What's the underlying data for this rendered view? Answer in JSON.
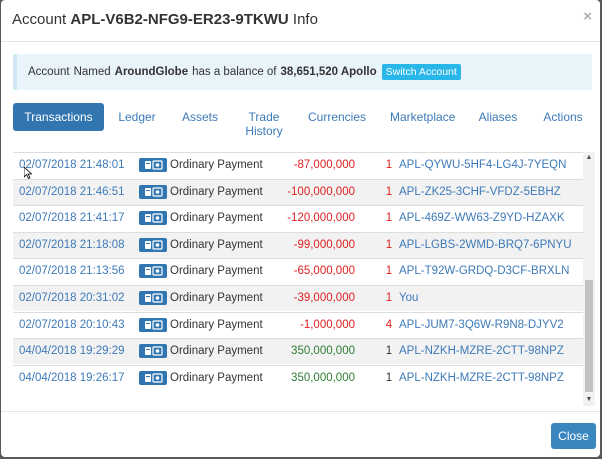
{
  "header": {
    "title_prefix": "Account",
    "account_id": "APL-V6B2-NFG9-ER23-9TKWU",
    "title_suffix": "Info",
    "close_glyph": "×"
  },
  "alert": {
    "prefix": "Account",
    "named": "Named",
    "name": "AroundGlobe",
    "balance_text": "has a balance of",
    "balance": "38,651,520 Apollo",
    "switch_label": "Switch Account"
  },
  "tabs": [
    {
      "label": "Transactions",
      "active": true
    },
    {
      "label": "Ledger"
    },
    {
      "label": "Assets"
    },
    {
      "label": "Trade",
      "label2": "History"
    },
    {
      "label": "Currencies"
    },
    {
      "label": "Marketplace"
    },
    {
      "label": "Aliases"
    },
    {
      "label": "Actions"
    }
  ],
  "transactions": [
    {
      "date": "02/07/2018 21:48:01",
      "type": "Ordinary Payment",
      "amount": "-87,000,000",
      "confirmations": "1",
      "account": "APL-QYWU-5HF4-LG4J-7YEQN"
    },
    {
      "date": "02/07/2018 21:46:51",
      "type": "Ordinary Payment",
      "amount": "-100,000,000",
      "confirmations": "1",
      "account": "APL-ZK25-3CHF-VFDZ-5EBHZ"
    },
    {
      "date": "02/07/2018 21:41:17",
      "type": "Ordinary Payment",
      "amount": "-120,000,000",
      "confirmations": "1",
      "account": "APL-469Z-WW63-Z9YD-HZAXK"
    },
    {
      "date": "02/07/2018 21:18:08",
      "type": "Ordinary Payment",
      "amount": "-99,000,000",
      "confirmations": "1",
      "account": "APL-LGBS-2WMD-BRQ7-6PNYU"
    },
    {
      "date": "02/07/2018 21:13:56",
      "type": "Ordinary Payment",
      "amount": "-65,000,000",
      "confirmations": "1",
      "account": "APL-T92W-GRDQ-D3CF-BRXLN"
    },
    {
      "date": "02/07/2018 20:31:02",
      "type": "Ordinary Payment",
      "amount": "-39,000,000",
      "confirmations": "1",
      "account": "You"
    },
    {
      "date": "02/07/2018 20:10:43",
      "type": "Ordinary Payment",
      "amount": "-1,000,000",
      "confirmations": "4",
      "account": "APL-JUM7-3Q6W-R9N8-DJYV2"
    },
    {
      "date": "04/04/2018 19:29:29",
      "type": "Ordinary Payment",
      "amount": "350,000,000",
      "confirmations": "1",
      "account": "APL-NZKH-MZRE-2CTT-98NPZ"
    },
    {
      "date": "04/04/2018 19:26:17",
      "type": "Ordinary Payment",
      "amount": "350,000,000",
      "confirmations": "1",
      "account": "APL-NZKH-MZRE-2CTT-98NPZ"
    }
  ],
  "icons": {
    "row_icon": "payment-icon",
    "scroll_up": "▲",
    "scroll_down": "▼"
  },
  "colors": {
    "negative": "#e02020",
    "positive": "#2e7d32",
    "link": "#3d7ab8",
    "primary": "#3276b1"
  },
  "footer": {
    "close_label": "Close"
  }
}
